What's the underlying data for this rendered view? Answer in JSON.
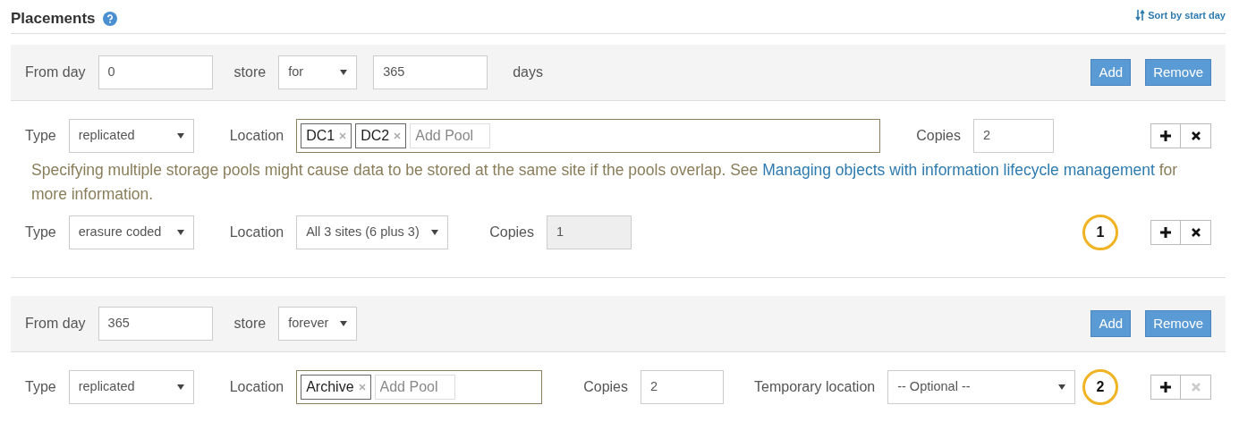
{
  "heading": {
    "title": "Placements",
    "sort_link": "Sort by start day"
  },
  "periods": [
    {
      "from_label": "From day",
      "from_value": "0",
      "store_label": "store",
      "store_mode": "for",
      "duration_value": "365",
      "duration_unit": "days",
      "add_label": "Add",
      "remove_label": "Remove",
      "rules": [
        {
          "kind": "pools",
          "type_label": "Type",
          "type": "replicated",
          "location_label": "Location",
          "pools": [
            "DC1",
            "DC2"
          ],
          "pool_placeholder": "Add Pool",
          "copies_label": "Copies",
          "copies": "2",
          "copies_disabled": false,
          "remove_disabled": false,
          "warning": "Specifying multiple storage pools might cause data to be stored at the same site if the pools overlap. See ",
          "warning_link": "Managing objects with information lifecycle management",
          "warning_tail": " for more information."
        },
        {
          "kind": "select",
          "type_label": "Type",
          "type": "erasure coded",
          "location_label": "Location",
          "location": "All 3 sites (6 plus 3)",
          "copies_label": "Copies",
          "copies": "1",
          "copies_disabled": true,
          "remove_disabled": false,
          "callout": "1"
        }
      ]
    },
    {
      "from_label": "From day",
      "from_value": "365",
      "store_label": "store",
      "store_mode": "forever",
      "add_label": "Add",
      "remove_label": "Remove",
      "rules": [
        {
          "kind": "pools",
          "type_label": "Type",
          "type": "replicated",
          "location_label": "Location",
          "pools": [
            "Archive"
          ],
          "pool_placeholder": "Add Pool",
          "copies_label": "Copies",
          "copies": "2",
          "copies_disabled": false,
          "temporary_label": "Temporary location",
          "temporary_location": "-- Optional --",
          "remove_disabled": true,
          "callout": "2"
        }
      ]
    }
  ]
}
